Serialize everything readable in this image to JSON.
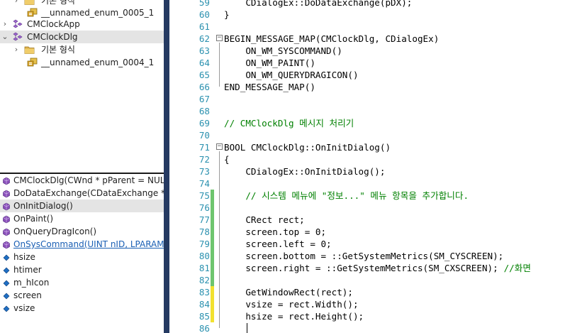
{
  "tree": {
    "items": [
      {
        "label": "기본 형식",
        "icon": "folder-icon",
        "arrow": "›"
      },
      {
        "label": "__unnamed_enum_0005_1",
        "icon": "enum-icon",
        "arrow": ""
      },
      {
        "label": "CMClockApp",
        "icon": "class-icon",
        "arrow": "›"
      },
      {
        "label": "CMClockDlg",
        "icon": "class-icon",
        "arrow": "⌄"
      },
      {
        "label": "기본 형식",
        "icon": "folder-icon",
        "arrow": "›"
      },
      {
        "label": "__unnamed_enum_0004_1",
        "icon": "enum-icon",
        "arrow": ""
      }
    ]
  },
  "members": [
    {
      "label": "CMClockDlg(CWnd * pParent = NULL)",
      "icon": "method-icon"
    },
    {
      "label": "DoDataExchange(CDataExchange * pDX)",
      "icon": "method-icon"
    },
    {
      "label": "OnInitDialog()",
      "icon": "method-icon"
    },
    {
      "label": "OnPaint()",
      "icon": "method-icon"
    },
    {
      "label": "OnQueryDragIcon()",
      "icon": "method-icon"
    },
    {
      "label": "OnSysCommand(UINT nID, LPARAM lParam)",
      "icon": "method-icon"
    },
    {
      "label": "hsize",
      "icon": "field-icon"
    },
    {
      "label": "htimer",
      "icon": "field-icon"
    },
    {
      "label": "m_hIcon",
      "icon": "field-icon"
    },
    {
      "label": "screen",
      "icon": "field-icon"
    },
    {
      "label": "vsize",
      "icon": "field-icon"
    }
  ],
  "colors": {
    "line_number": "#2b91af",
    "comment": "#008000",
    "change_saved": "#6ec56e",
    "change_unsaved": "#f2e12f",
    "method_icon": "#8a4fb9",
    "field_icon": "#1f6fc4",
    "divider": "#253a62"
  },
  "code": {
    "lines": [
      {
        "num": "59",
        "text": "    CDialogEx::DoDataExchange(pDX);",
        "comment": false,
        "change": ""
      },
      {
        "num": "60",
        "text": "}",
        "comment": false,
        "change": ""
      },
      {
        "num": "61",
        "text": "",
        "comment": false,
        "change": ""
      },
      {
        "num": "62",
        "text": "BEGIN_MESSAGE_MAP(CMClockDlg, CDialogEx)",
        "comment": false,
        "change": "",
        "fold": "−"
      },
      {
        "num": "63",
        "text": "    ON_WM_SYSCOMMAND()",
        "comment": false,
        "change": ""
      },
      {
        "num": "64",
        "text": "    ON_WM_PAINT()",
        "comment": false,
        "change": ""
      },
      {
        "num": "65",
        "text": "    ON_WM_QUERYDRAGICON()",
        "comment": false,
        "change": ""
      },
      {
        "num": "66",
        "text": "END_MESSAGE_MAP()",
        "comment": false,
        "change": ""
      },
      {
        "num": "67",
        "text": "",
        "comment": false,
        "change": ""
      },
      {
        "num": "68",
        "text": "",
        "comment": false,
        "change": ""
      },
      {
        "num": "69",
        "text": "// CMClockDlg 메시지 처리기",
        "comment": true,
        "change": ""
      },
      {
        "num": "70",
        "text": "",
        "comment": false,
        "change": ""
      },
      {
        "num": "71",
        "text": "BOOL CMClockDlg::OnInitDialog()",
        "comment": false,
        "change": "",
        "fold": "−"
      },
      {
        "num": "72",
        "text": "{",
        "comment": false,
        "change": ""
      },
      {
        "num": "73",
        "text": "    CDialogEx::OnInitDialog();",
        "comment": false,
        "change": ""
      },
      {
        "num": "74",
        "text": "",
        "comment": false,
        "change": ""
      },
      {
        "num": "75",
        "text": "    // 시스템 메뉴에 \"정보...\" 메뉴 항목을 추가합니다.",
        "comment": true,
        "change": "saved"
      },
      {
        "num": "76",
        "text": "",
        "comment": false,
        "change": "saved"
      },
      {
        "num": "77",
        "text": "    CRect rect;",
        "comment": false,
        "change": "saved"
      },
      {
        "num": "78",
        "text": "    screen.top = 0;",
        "comment": false,
        "change": "saved"
      },
      {
        "num": "79",
        "text": "    screen.left = 0;",
        "comment": false,
        "change": "saved"
      },
      {
        "num": "80",
        "text": "    screen.bottom = ::GetSystemMetrics(SM_CYSCREEN);",
        "comment": false,
        "change": "saved"
      },
      {
        "num": "81",
        "text": "    screen.right = ::GetSystemMetrics(SM_CXSCREEN);",
        "comment": false,
        "change": "saved",
        "tail": " //화면"
      },
      {
        "num": "82",
        "text": "",
        "comment": false,
        "change": "saved"
      },
      {
        "num": "83",
        "text": "    GetWindowRect(rect);",
        "comment": false,
        "change": "unsaved"
      },
      {
        "num": "84",
        "text": "    vsize = rect.Width();",
        "comment": false,
        "change": "unsaved"
      },
      {
        "num": "85",
        "text": "    hsize = rect.Height();",
        "comment": false,
        "change": "unsaved"
      },
      {
        "num": "86",
        "text": "",
        "comment": false,
        "change": "",
        "caret": true
      }
    ]
  }
}
